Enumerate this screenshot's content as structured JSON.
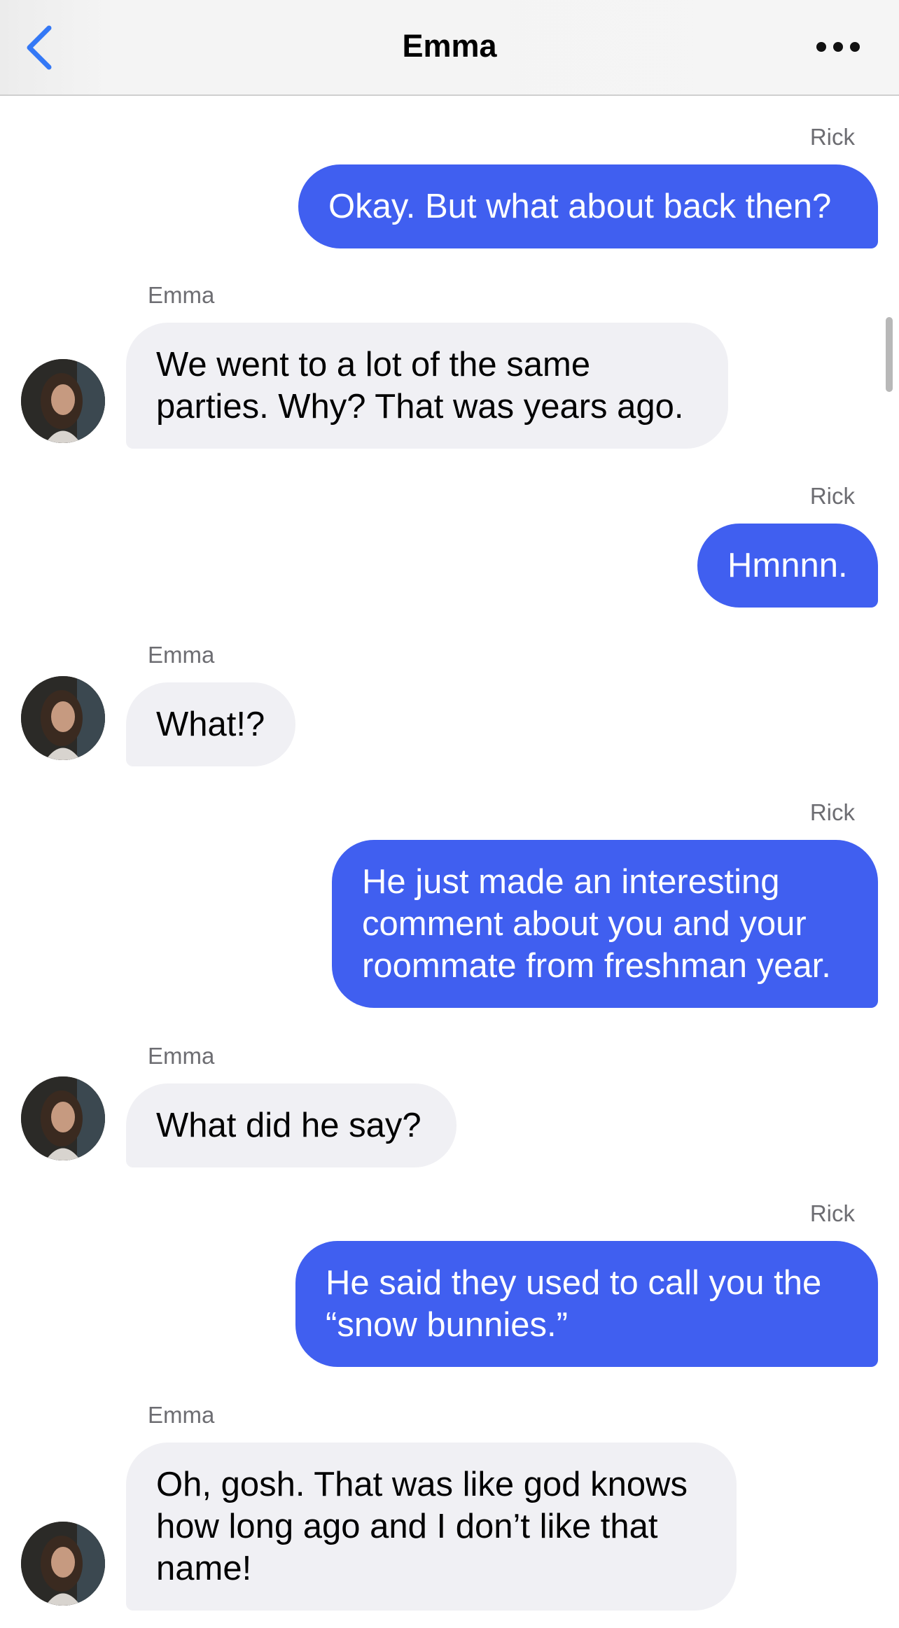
{
  "header": {
    "title": "Emma",
    "back_icon": "chevron-left-icon",
    "more_icon": "ellipsis-icon",
    "accent_color": "#3478f6"
  },
  "colors": {
    "outgoing_bubble": "#405ff0",
    "incoming_bubble": "#f0f0f4"
  },
  "messages": [
    {
      "sender": "Rick",
      "direction": "outgoing",
      "lines": [
        "Okay. But what about back then?"
      ]
    },
    {
      "sender": "Emma",
      "direction": "incoming",
      "lines": [
        "We went to a lot of the same",
        "parties. Why? That was years ago."
      ]
    },
    {
      "sender": "Rick",
      "direction": "outgoing",
      "lines": [
        "Hmnnn."
      ]
    },
    {
      "sender": "Emma",
      "direction": "incoming",
      "lines": [
        "What!?"
      ]
    },
    {
      "sender": "Rick",
      "direction": "outgoing",
      "lines": [
        "He just made an interesting",
        "comment about you and your",
        "roommate from freshman year."
      ]
    },
    {
      "sender": "Emma",
      "direction": "incoming",
      "lines": [
        "What did he say?"
      ]
    },
    {
      "sender": "Rick",
      "direction": "outgoing",
      "lines": [
        "He said they used to call you the",
        "“snow bunnies.”"
      ]
    },
    {
      "sender": "Emma",
      "direction": "incoming",
      "lines": [
        "Oh, gosh. That was like god knows",
        "how long ago and I don’t like that",
        "name!"
      ]
    }
  ]
}
